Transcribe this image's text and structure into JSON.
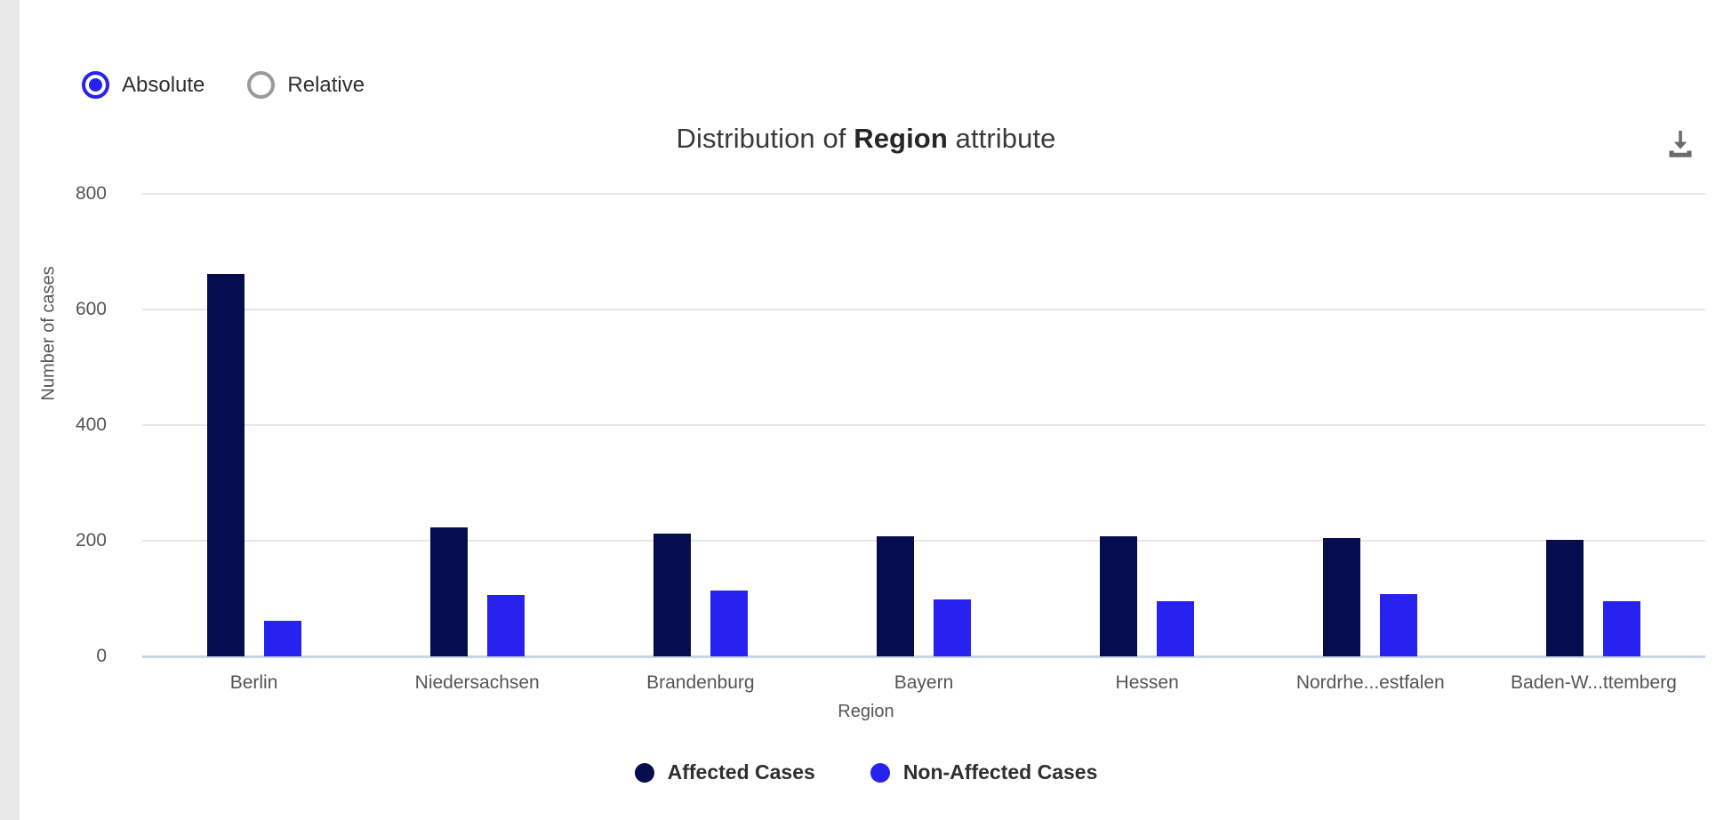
{
  "controls": {
    "scale_mode": {
      "selected": "Absolute",
      "options": [
        {
          "label": "Absolute",
          "checked": true
        },
        {
          "label": "Relative",
          "checked": false
        }
      ]
    }
  },
  "header": {
    "title_prefix": "Distribution of ",
    "title_emphasis": "Region",
    "title_suffix": " attribute",
    "download_icon": "download-icon",
    "download_tooltip": "Download"
  },
  "colors": {
    "affected": "#050D4E",
    "non_affected": "#2722F0",
    "grid": "#E7E7E7",
    "axis_zero": "#C9D4E6",
    "text": "#555555",
    "page_background": "#FFFFFF",
    "gutter": "#E9E9E9"
  },
  "chart_data": {
    "type": "bar",
    "title": "Distribution of Region attribute",
    "xlabel": "Region",
    "ylabel": "Number of cases",
    "ylim": [
      0,
      800
    ],
    "yticks": [
      0,
      200,
      400,
      600,
      800
    ],
    "ytick_labels": [
      "0",
      "200",
      "400",
      "600",
      "800"
    ],
    "grid": true,
    "legend_position": "bottom",
    "grouping": "grouped",
    "categories": [
      "Berlin",
      "Niedersachsen",
      "Brandenburg",
      "Bayern",
      "Hessen",
      "Nordrhe...estfalen",
      "Baden-W...ttemberg"
    ],
    "series": [
      {
        "name": "Affected Cases",
        "color": "#050D4E",
        "values": [
          661,
          223,
          212,
          207,
          208,
          205,
          202
        ]
      },
      {
        "name": "Non-Affected Cases",
        "color": "#2722F0",
        "values": [
          61,
          106,
          114,
          99,
          95,
          108,
          96
        ]
      }
    ]
  }
}
